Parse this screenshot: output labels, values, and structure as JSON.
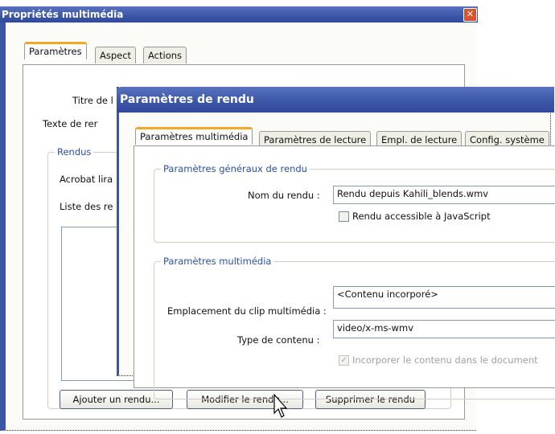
{
  "outer": {
    "title": "Propriétés multimédia",
    "tabs": [
      "Paramètres",
      "Aspect",
      "Actions"
    ],
    "labels": {
      "titre": "Titre de l",
      "texte": "Texte de rer",
      "rendus": "Rendus",
      "acrobat": "Acrobat lira",
      "liste": "Liste des re"
    },
    "buttons": {
      "add": "Ajouter un rendu...",
      "modify": "Modifier le rendu...",
      "delete": "Supprimer le rendu"
    }
  },
  "inner": {
    "title": "Paramètres de rendu",
    "tabs": [
      "Paramètres multimédia",
      "Paramètres de lecture",
      "Empl. de lecture",
      "Config. système"
    ],
    "general": {
      "legend": "Paramètres généraux de rendu",
      "name_label": "Nom du rendu :",
      "name_value": "Rendu depuis Kahili_blends.wmv",
      "js_label": "Rendu accessible à JavaScript",
      "js_checked": false
    },
    "media": {
      "legend": "Paramètres multimédia",
      "location_label": "Emplacement du clip multimédia :",
      "location_value": "<Contenu incorporé>",
      "type_label": "Type de contenu :",
      "type_value": "video/x-ms-wmv",
      "embed_label": "Incorporer le contenu dans le document",
      "embed_checked": true
    }
  }
}
